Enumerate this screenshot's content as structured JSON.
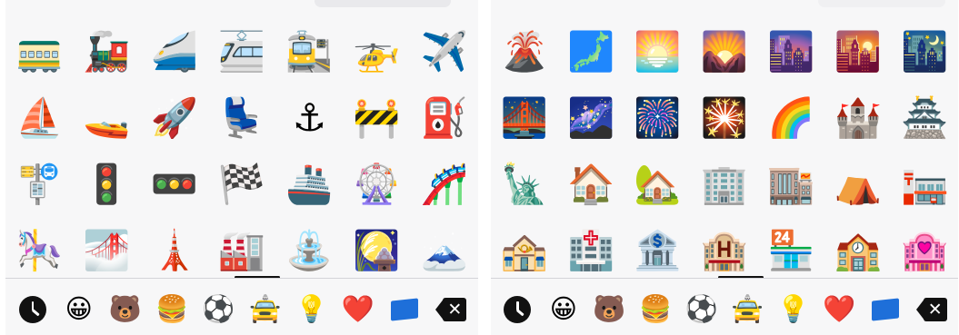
{
  "left_panel": {
    "emojis": [
      {
        "name": "railway-car-icon",
        "glyph": "🚃"
      },
      {
        "name": "locomotive-icon",
        "glyph": "🚂"
      },
      {
        "name": "high-speed-train-icon",
        "glyph": "🚄"
      },
      {
        "name": "light-rail-icon",
        "glyph": "🚈"
      },
      {
        "name": "station-icon",
        "glyph": "🚉"
      },
      {
        "name": "helicopter-icon",
        "glyph": "🚁"
      },
      {
        "name": "airplane-icon",
        "glyph": "✈️"
      },
      {
        "name": "sailboat-icon",
        "glyph": "⛵"
      },
      {
        "name": "speedboat-icon",
        "glyph": "🚤"
      },
      {
        "name": "rocket-icon",
        "glyph": "🚀"
      },
      {
        "name": "seat-icon",
        "glyph": "💺"
      },
      {
        "name": "anchor-icon",
        "glyph": "⚓"
      },
      {
        "name": "construction-icon",
        "glyph": "🚧"
      },
      {
        "name": "fuel-pump-icon",
        "glyph": "⛽"
      },
      {
        "name": "bus-stop-icon",
        "glyph": "🚏"
      },
      {
        "name": "vertical-traffic-light-icon",
        "glyph": "🚦"
      },
      {
        "name": "horizontal-traffic-light-icon",
        "glyph": "🚥"
      },
      {
        "name": "chequered-flag-icon",
        "glyph": "🏁"
      },
      {
        "name": "ship-icon",
        "glyph": "🚢"
      },
      {
        "name": "ferris-wheel-icon",
        "glyph": "🎡"
      },
      {
        "name": "roller-coaster-icon",
        "glyph": "🎢"
      },
      {
        "name": "carousel-horse-icon",
        "glyph": "🎠"
      },
      {
        "name": "foggy-icon",
        "glyph": "🌁"
      },
      {
        "name": "tokyo-tower-icon",
        "glyph": "🗼"
      },
      {
        "name": "factory-icon",
        "glyph": "🏭"
      },
      {
        "name": "fountain-icon",
        "glyph": "⛲"
      },
      {
        "name": "moon-viewing-ceremony-icon",
        "glyph": "🎑"
      },
      {
        "name": "mount-fuji-icon",
        "glyph": "🗻"
      }
    ]
  },
  "right_panel": {
    "emojis": [
      {
        "name": "volcano-icon",
        "glyph": "🌋"
      },
      {
        "name": "map-of-japan-icon",
        "glyph": "🗾"
      },
      {
        "name": "sunrise-icon",
        "glyph": "🌅"
      },
      {
        "name": "sunrise-over-mountains-icon",
        "glyph": "🌄"
      },
      {
        "name": "cityscape-at-dusk-icon",
        "glyph": "🌆"
      },
      {
        "name": "sunset-icon",
        "glyph": "🌇"
      },
      {
        "name": "night-with-stars-icon",
        "glyph": "🌃"
      },
      {
        "name": "bridge-at-night-icon",
        "glyph": "🌉"
      },
      {
        "name": "milky-way-icon",
        "glyph": "🌌"
      },
      {
        "name": "fireworks-icon",
        "glyph": "🎆"
      },
      {
        "name": "sparkler-icon",
        "glyph": "🎇"
      },
      {
        "name": "rainbow-icon",
        "glyph": "🌈"
      },
      {
        "name": "european-castle-icon",
        "glyph": "🏰"
      },
      {
        "name": "japanese-castle-icon",
        "glyph": "🏯"
      },
      {
        "name": "statue-of-liberty-icon",
        "glyph": "🗽"
      },
      {
        "name": "house-icon",
        "glyph": "🏠"
      },
      {
        "name": "house-with-garden-icon",
        "glyph": "🏡"
      },
      {
        "name": "office-building-icon",
        "glyph": "🏢"
      },
      {
        "name": "department-store-icon",
        "glyph": "🏬"
      },
      {
        "name": "tent-icon",
        "glyph": "⛺"
      },
      {
        "name": "japanese-post-office-icon",
        "glyph": "🏣"
      },
      {
        "name": "post-office-icon",
        "glyph": "🏤"
      },
      {
        "name": "hospital-icon",
        "glyph": "🏥"
      },
      {
        "name": "bank-icon",
        "glyph": "🏦"
      },
      {
        "name": "hotel-icon",
        "glyph": "🏨"
      },
      {
        "name": "convenience-store-icon",
        "glyph": "🏪"
      },
      {
        "name": "school-icon",
        "glyph": "🏫"
      },
      {
        "name": "love-hotel-icon",
        "glyph": "🏩"
      }
    ]
  },
  "category_bar": [
    {
      "name": "recent-clock-icon",
      "glyph": ""
    },
    {
      "name": "smileys-category-icon",
      "glyph": "😀"
    },
    {
      "name": "animals-category-icon",
      "glyph": "🐻"
    },
    {
      "name": "food-category-icon",
      "glyph": "🍔"
    },
    {
      "name": "activity-category-icon",
      "glyph": "⚽"
    },
    {
      "name": "travel-category-icon",
      "glyph": "🚖"
    },
    {
      "name": "objects-category-icon",
      "glyph": "💡"
    },
    {
      "name": "symbols-category-icon",
      "glyph": "❤️"
    },
    {
      "name": "flags-category-icon",
      "glyph": ""
    },
    {
      "name": "backspace-icon",
      "glyph": ""
    }
  ],
  "colors": {
    "panel_bg": "#f7f7f8",
    "icon_dark": "#111111",
    "flag_blue": "#1e6fd9"
  }
}
